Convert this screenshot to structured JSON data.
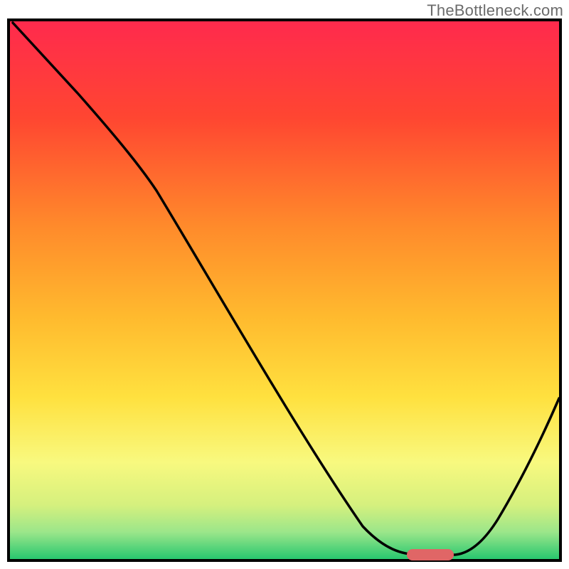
{
  "watermark": "TheBottleneck.com",
  "colors": {
    "border": "#000000",
    "white": "#ffffff",
    "curve": "#000000",
    "marker_fill": "#d9534f",
    "grad_top": "#ff2a4d",
    "grad_mid1": "#ff7a2a",
    "grad_mid2": "#ffd23f",
    "grad_mid3": "#f7f98e",
    "grad_low1": "#d9f28a",
    "grad_low2": "#7fe08b",
    "grad_bottom": "#28c76f"
  },
  "chart_data": {
    "type": "line",
    "title": "",
    "xlabel": "",
    "ylabel": "",
    "xlim": [
      0,
      100
    ],
    "ylim": [
      0,
      100
    ],
    "series": [
      {
        "name": "bottleneck-curve",
        "x": [
          0,
          8,
          18,
          25,
          35,
          45,
          55,
          62,
          68,
          72,
          76,
          80,
          85,
          90,
          95,
          100
        ],
        "values": [
          100,
          92,
          80,
          72,
          57,
          42,
          28,
          17,
          8,
          3,
          1,
          1,
          3,
          10,
          20,
          32
        ]
      }
    ],
    "marker": {
      "x_range": [
        72,
        80
      ],
      "y": 1
    },
    "annotations": []
  }
}
